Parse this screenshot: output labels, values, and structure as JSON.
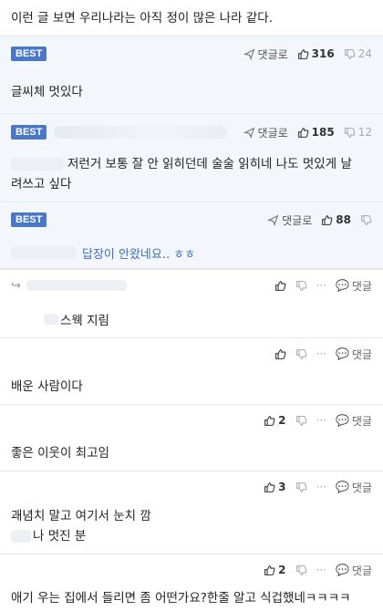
{
  "top_text": "이런 글 보면 우리나라는 아직 정이 많은 나라 같다.",
  "best_badge_label": "BEST",
  "reply_link_label": "댓글로",
  "reply_button_label": "댓글",
  "more_label": "···",
  "best_comments": [
    {
      "likes": "316",
      "dislikes": "24",
      "body": "글씨체 멋있다"
    },
    {
      "likes": "185",
      "dislikes": "12",
      "body": "저런거 보통 잘 안 읽히던데 술술 읽히네 나도 멋있게 날 려쓰고 싶다",
      "body_line1": "저런거 보통 잘 안 읽히던데 술술 읽히네 나도 멋있게 날",
      "body_line2": "려쓰고 싶다"
    },
    {
      "likes": "88",
      "dislikes": "",
      "body": "답장이 안왔네요.. ㅎㅎ"
    }
  ],
  "replies": [
    {
      "likes": "",
      "body": "스웩 지림"
    },
    {
      "likes": "",
      "body": "배운 사람이다"
    },
    {
      "likes": "2",
      "body": "좋은 이웃이 최고임"
    },
    {
      "likes": "3",
      "body_line1": "괘념치 말고 여기서 눈치 깜",
      "body_line2": "나 멋진 분"
    },
    {
      "likes": "2",
      "body": "애기 우는 집에서 들리면 좀 어떤가요?한줄 알고 식겁했네ㅋㅋㅋㅋ"
    }
  ],
  "colors": {
    "best_badge": "#4a78c8",
    "best_background": "#f3f7fb",
    "reply_link": "#3b6cc4"
  }
}
